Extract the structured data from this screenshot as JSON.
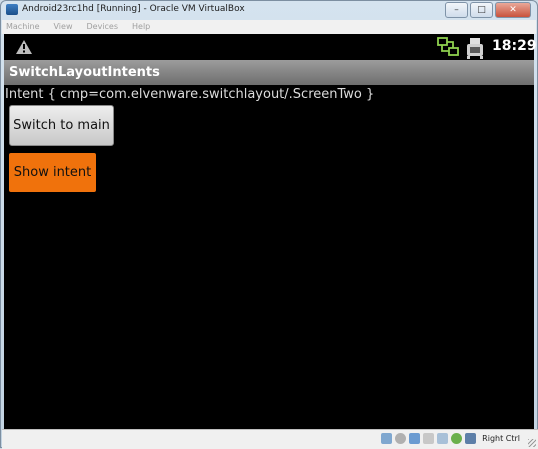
{
  "window": {
    "title": "Android23rc1hd [Running] - Oracle VM VirtualBox",
    "minimize_glyph": "–",
    "maximize_glyph": "□",
    "close_glyph": "✕"
  },
  "menubar": {
    "items": [
      "Machine",
      "View",
      "Devices",
      "Help"
    ]
  },
  "android": {
    "status_bar": {
      "time": "18:29",
      "icons": [
        "warning-icon",
        "network-icon",
        "usb-icon"
      ]
    },
    "app_title": "SwitchLayoutIntents",
    "intent_text": "Intent { cmp=com.elvenware.switchlayout/.ScreenTwo }",
    "buttons": {
      "switch_to_main": "Switch to main",
      "show_intent": "Show intent"
    }
  },
  "host_status": {
    "host_key_label": "Right Ctrl",
    "tray_icons": [
      "hard-disk-icon",
      "optical-drive-icon",
      "network-adapter-icon",
      "usb-device-icon",
      "shared-folders-icon",
      "virtualization-icon",
      "mouse-integration-icon"
    ]
  },
  "colors": {
    "accent_button": "#f0720c",
    "action_bar": "#8a8a8a",
    "screen_bg": "#000000"
  }
}
